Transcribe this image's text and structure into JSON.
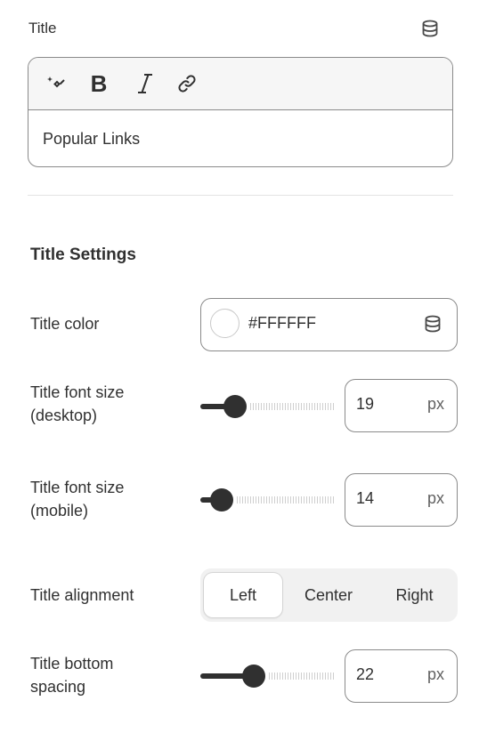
{
  "title_field": {
    "label": "Title",
    "value": "Popular Links",
    "dynamic_source_icon": "database-icon",
    "toolbar": {
      "magic_icon": "sparkle-icon",
      "bold_label": "B",
      "italic_icon": "italic-icon",
      "link_icon": "link-icon"
    }
  },
  "settings": {
    "section_title": "Title Settings",
    "color": {
      "label": "Title color",
      "value": "#FFFFFF",
      "swatch_color": "#FFFFFF",
      "source_icon": "database-icon"
    },
    "font_size_desktop": {
      "label_line1": "Title font size",
      "label_line2": "(desktop)",
      "value": "19",
      "unit": "px",
      "slider_fraction": 0.26
    },
    "font_size_mobile": {
      "label_line1": "Title font size",
      "label_line2": "(mobile)",
      "value": "14",
      "unit": "px",
      "slider_fraction": 0.16
    },
    "alignment": {
      "label": "Title alignment",
      "options": [
        "Left",
        "Center",
        "Right"
      ],
      "selected": "Left"
    },
    "bottom_spacing": {
      "label_line1": "Title bottom",
      "label_line2": "spacing",
      "value": "22",
      "unit": "px",
      "slider_fraction": 0.4
    }
  }
}
